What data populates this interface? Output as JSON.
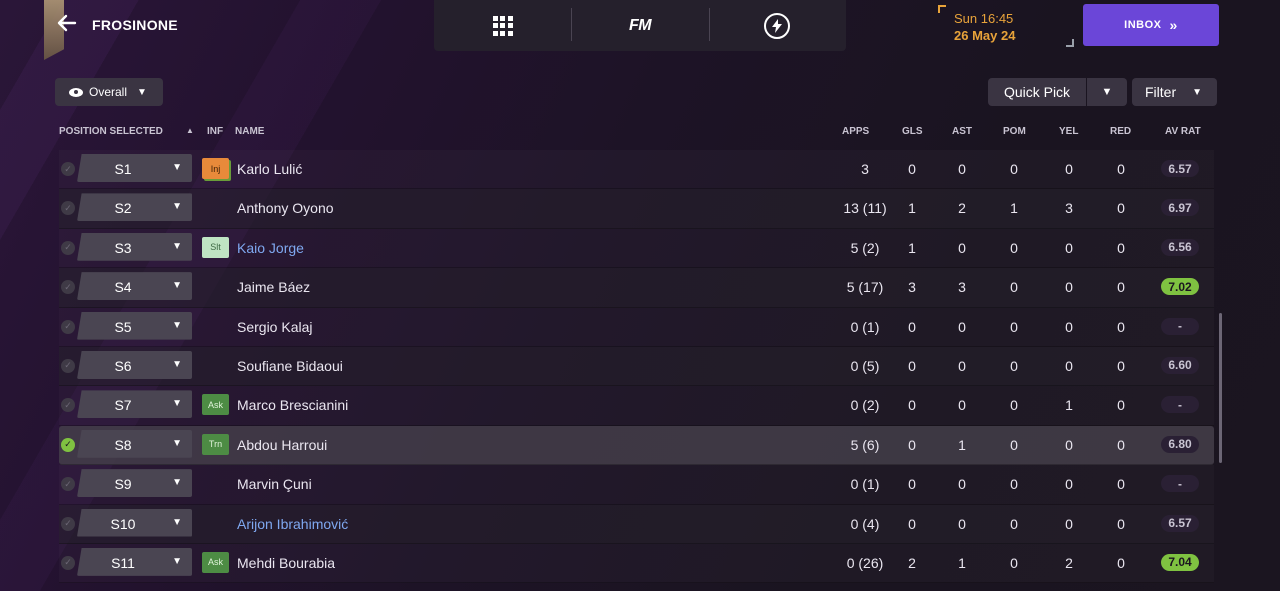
{
  "header": {
    "club_name": "FROSINONE",
    "back_icon": "arrow-left-icon",
    "date_time": "Sun 16:45",
    "date_day": "26 May 24",
    "inbox_label": "INBOX",
    "fm_label": "FM"
  },
  "toolbar": {
    "overall_label": "Overall",
    "quick_pick_label": "Quick Pick",
    "filter_label": "Filter"
  },
  "columns": {
    "position": "POSITION SELECTED",
    "inf": "INF",
    "name": "NAME",
    "apps": "APPS",
    "gls": "GLS",
    "ast": "AST",
    "pom": "POM",
    "yel": "YEL",
    "red": "RED",
    "avrat": "AV RAT"
  },
  "players": [
    {
      "pos": "S1",
      "inf": "Inj",
      "name": "Karlo Lulić",
      "apps": "3",
      "gls": "0",
      "ast": "0",
      "pom": "0",
      "yel": "0",
      "red": "0",
      "rat": "6.57"
    },
    {
      "pos": "S2",
      "inf": "",
      "name": "Anthony Oyono",
      "apps": "13 (11)",
      "gls": "1",
      "ast": "2",
      "pom": "1",
      "yel": "3",
      "red": "0",
      "rat": "6.97"
    },
    {
      "pos": "S3",
      "inf": "Slt",
      "name": "Kaio Jorge",
      "apps": "5 (2)",
      "gls": "1",
      "ast": "0",
      "pom": "0",
      "yel": "0",
      "red": "0",
      "rat": "6.56"
    },
    {
      "pos": "S4",
      "inf": "",
      "name": "Jaime Báez",
      "apps": "5 (17)",
      "gls": "3",
      "ast": "3",
      "pom": "0",
      "yel": "0",
      "red": "0",
      "rat": "7.02"
    },
    {
      "pos": "S5",
      "inf": "",
      "name": "Sergio Kalaj",
      "apps": "0 (1)",
      "gls": "0",
      "ast": "0",
      "pom": "0",
      "yel": "0",
      "red": "0",
      "rat": "-"
    },
    {
      "pos": "S6",
      "inf": "",
      "name": "Soufiane Bidaoui",
      "apps": "0 (5)",
      "gls": "0",
      "ast": "0",
      "pom": "0",
      "yel": "0",
      "red": "0",
      "rat": "6.60"
    },
    {
      "pos": "S7",
      "inf": "Ask",
      "name": "Marco Brescianini",
      "apps": "0 (2)",
      "gls": "0",
      "ast": "0",
      "pom": "0",
      "yel": "1",
      "red": "0",
      "rat": "-"
    },
    {
      "pos": "S8",
      "inf": "Trn",
      "name": "Abdou Harroui",
      "apps": "5 (6)",
      "gls": "0",
      "ast": "1",
      "pom": "0",
      "yel": "0",
      "red": "0",
      "rat": "6.80"
    },
    {
      "pos": "S9",
      "inf": "",
      "name": "Marvin Çuni",
      "apps": "0 (1)",
      "gls": "0",
      "ast": "0",
      "pom": "0",
      "yel": "0",
      "red": "0",
      "rat": "-"
    },
    {
      "pos": "S10",
      "inf": "",
      "name": "Arijon Ibrahimović",
      "apps": "0 (4)",
      "gls": "0",
      "ast": "0",
      "pom": "0",
      "yel": "0",
      "red": "0",
      "rat": "6.57"
    },
    {
      "pos": "S11",
      "inf": "Ask",
      "name": "Mehdi Bourabia",
      "apps": "0 (26)",
      "gls": "2",
      "ast": "1",
      "pom": "0",
      "yel": "2",
      "red": "0",
      "rat": "7.04"
    }
  ],
  "colors": {
    "accent": "#6b46d8",
    "date": "#e8a33a",
    "rating_high": "#7fc241",
    "link_name": "#7fa8f0"
  }
}
